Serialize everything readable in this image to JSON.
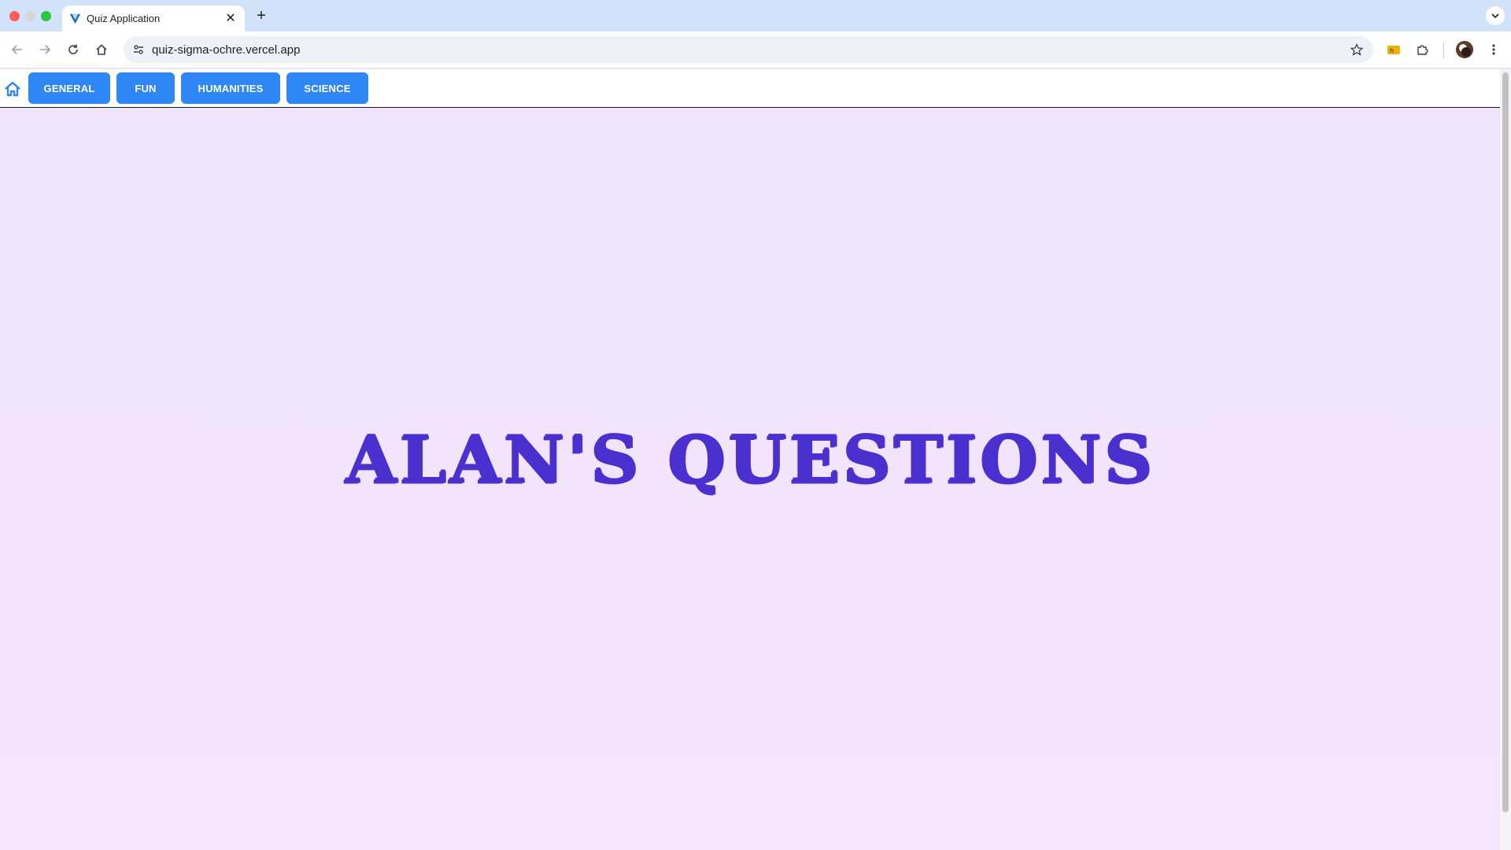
{
  "browser": {
    "tab_title": "Quiz Application",
    "url": "quiz-sigma-ochre.vercel.app",
    "icons": [
      "close-icon",
      "plus-icon",
      "back-icon",
      "forward-icon",
      "reload-icon",
      "home-icon",
      "site-info-icon",
      "star-icon",
      "extension-icon",
      "puzzle-icon",
      "menu-icon"
    ]
  },
  "nav": {
    "buttons": [
      {
        "label": "GENERAL"
      },
      {
        "label": "FUN"
      },
      {
        "label": "HUMANITIES"
      },
      {
        "label": "SCIENCE"
      }
    ]
  },
  "hero": {
    "title": "ALAN'S QUESTIONS"
  },
  "colors": {
    "nav_button": "#2f86f5",
    "title": "#4a30cf",
    "page_bg": "#f2e6fc",
    "home_icon": "#2f86f5"
  }
}
